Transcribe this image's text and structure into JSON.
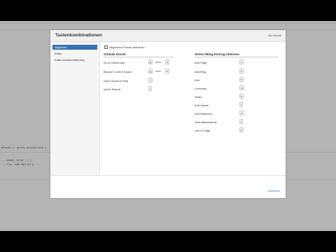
{
  "background": {
    "code_line_1": "Blocks ( quick_exceptions ) ...",
    "code_line_2": "...ound( hrnd: ) {",
    "code_line_3": "...llo, New World\");"
  },
  "dialog": {
    "title": "Tastenkombinationen",
    "all_keys_label": "Alle Kürzel",
    "close_label": "Schließen"
  },
  "sidebar": {
    "items": [
      {
        "label": "Allgemein",
        "active": true
      },
      {
        "label": "Editor",
        "active": false
      },
      {
        "label": "Editor-Autoformatierung",
        "active": false
      }
    ]
  },
  "content": {
    "checkbox_label": "Allgemeine Kürzel aktivieren",
    "checkbox_checked": true,
    "global": {
      "title": "Globale Kürzel",
      "then_label": "dann",
      "rows": [
        {
          "label": "Go to Dashboard",
          "key1": "g",
          "key2": "d"
        },
        {
          "label": "Browse Current Space",
          "key1": "g",
          "key2": "s"
        },
        {
          "label": "Open Shortcut Help",
          "key1": "?"
        },
        {
          "label": "Quick Search",
          "key1": "/"
        }
      ]
    },
    "page": {
      "title": "Seiten-/Blog-Eintrag-Aktionen",
      "rows": [
        {
          "label": "Add Page",
          "key": "c"
        },
        {
          "label": "Add Blog",
          "key": "b"
        },
        {
          "label": "Edit",
          "key": "e"
        },
        {
          "label": "Comment",
          "key": "m"
        },
        {
          "label": "Share",
          "key": "k"
        },
        {
          "label": "Edit Labels",
          "key": "l"
        },
        {
          "label": "Edit Watchers",
          "key": "w"
        },
        {
          "label": "View Attachments",
          "key": "t"
        },
        {
          "label": "Link to Page",
          "key": "k"
        }
      ]
    }
  },
  "colors": {
    "accent": "#3572b0",
    "overlay": "#b4b4b4"
  }
}
